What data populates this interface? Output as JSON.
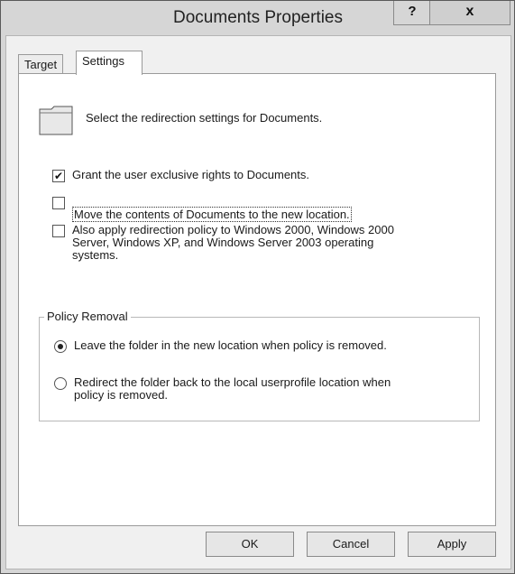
{
  "window": {
    "title": "Documents Properties",
    "help_label": "?",
    "close_label": "x"
  },
  "tabs": [
    {
      "label": "Target",
      "selected": false
    },
    {
      "label": "Settings",
      "selected": true
    }
  ],
  "settings": {
    "intro_text": "Select the redirection settings for Documents.",
    "checkboxes": [
      {
        "label": "Grant the user exclusive rights to Documents.",
        "checked": true
      },
      {
        "label": "Move the contents of Documents to the new location.",
        "checked": false
      },
      {
        "label": "Also apply redirection policy to Windows 2000, Windows 2000\nServer, Windows XP, and Windows Server 2003 operating\nsystems.",
        "checked": false
      }
    ],
    "policy_removal": {
      "title": "Policy Removal",
      "options": [
        {
          "label": "Leave the folder in the new location when policy is removed.",
          "selected": true
        },
        {
          "label": "Redirect the folder back to the local userprofile location when\npolicy is removed.",
          "selected": false
        }
      ]
    }
  },
  "buttons": {
    "ok_label": "OK",
    "cancel_label": "Cancel",
    "apply_label": "Apply"
  }
}
